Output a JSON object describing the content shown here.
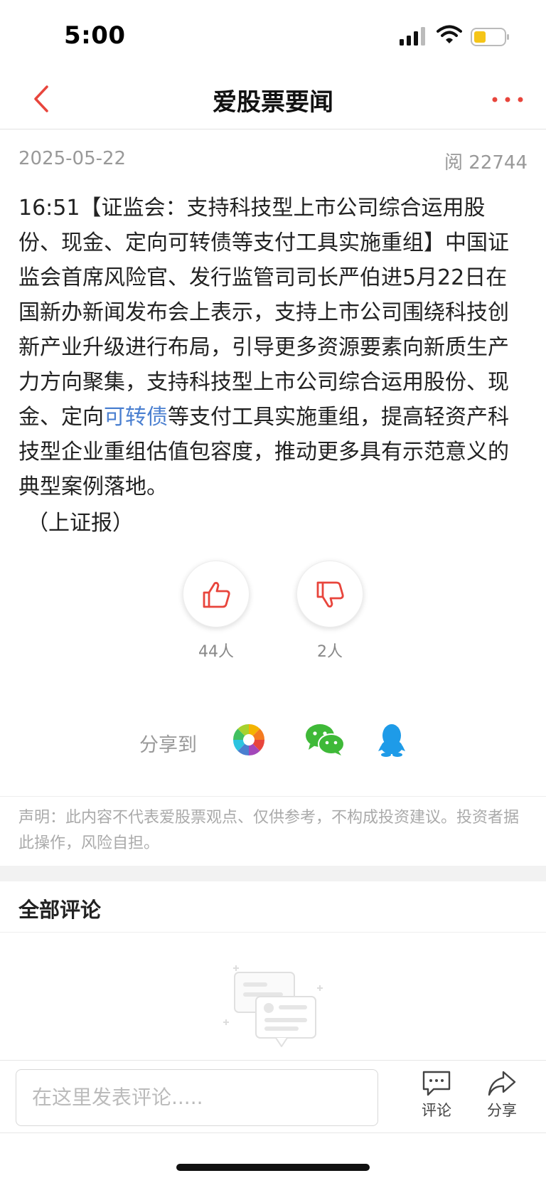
{
  "status_bar": {
    "time": "5:00"
  },
  "nav": {
    "title": "爱股票要闻"
  },
  "article": {
    "date": "2025-05-22",
    "reads": "阅 22744",
    "body_before_link": "16:51【证监会：支持科技型上市公司综合运用股份、现金、定向可转债等支付工具实施重组】中国证监会首席风险官、发行监管司司长严伯进5月22日在国新办新闻发布会上表示，支持上市公司围绕科技创新产业升级进行布局，引导更多资源要素向新质生产力方向聚集，支持科技型上市公司综合运用股份、现金、定向",
    "link_text": "可转债",
    "body_after_link": "等支付工具实施重组，提高轻资产科技型企业重组估值包容度，推动更多具有示范意义的典型案例落地。",
    "source": "（上证报）"
  },
  "votes": {
    "like_count": "44人",
    "dislike_count": "2人"
  },
  "share": {
    "label": "分享到"
  },
  "disclaimer": "声明：此内容不代表爱股票观点、仅供参考，不构成投资建议。投资者据此操作，风险自担。",
  "comments": {
    "title": "全部评论"
  },
  "bottom_bar": {
    "input_placeholder": "在这里发表评论.....",
    "comment_label": "评论",
    "share_label": "分享"
  },
  "colors": {
    "accent": "#e8453c",
    "link": "#4a7fd0",
    "battery": "#f5c518"
  }
}
